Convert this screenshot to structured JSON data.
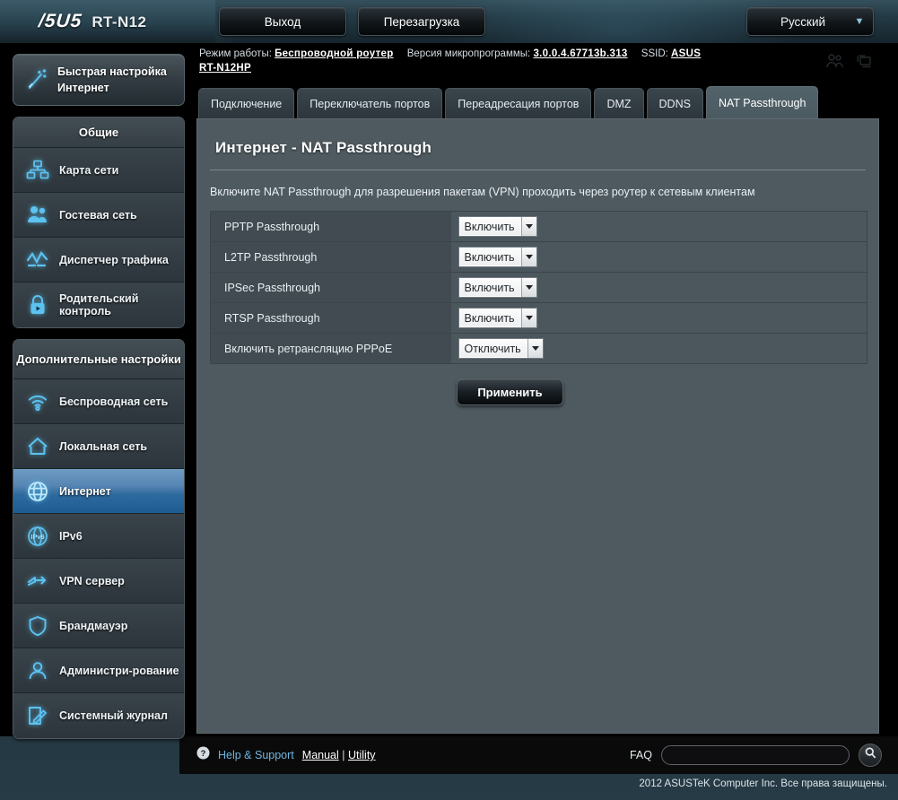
{
  "header": {
    "brand": "/5U5",
    "model": "RT-N12",
    "logout_label": "Выход",
    "reboot_label": "Перезагрузка",
    "language": "Русский",
    "language_caret": "chevron-down-icon"
  },
  "infobar": {
    "mode_label": "Режим работы:",
    "mode_value": "Беспроводной  роутер",
    "firmware_label": "Версия микропрограммы:",
    "firmware_value": "3.0.0.4.67713b.313",
    "ssid_label": "SSID:",
    "ssid_value": "ASUS",
    "ssid_value2": "RT-N12HP",
    "icons": [
      "clients-icon",
      "devices-icon"
    ]
  },
  "tabs": [
    {
      "label": "Подключение",
      "active": false
    },
    {
      "label": "Переключатель портов",
      "active": false
    },
    {
      "label": "Переадресация портов",
      "active": false
    },
    {
      "label": "DMZ",
      "active": false
    },
    {
      "label": "DDNS",
      "active": false
    },
    {
      "label": "NAT Passthrough",
      "active": true
    }
  ],
  "sidebar": {
    "quick_setup": {
      "line1": "Быстрая настройка",
      "line2": "Интернет",
      "icon": "wand-icon"
    },
    "groups": [
      {
        "title": "Общие",
        "items": [
          {
            "label": "Карта сети",
            "icon": "network-map-icon",
            "active": false
          },
          {
            "label": "Гостевая сеть",
            "icon": "guest-network-icon",
            "active": false
          },
          {
            "label": "Диспетчер трафика",
            "icon": "traffic-manager-icon",
            "active": false
          },
          {
            "label": "Родительский контроль",
            "icon": "parental-control-icon",
            "active": false
          }
        ]
      },
      {
        "title": "Дополнительные настройки",
        "items": [
          {
            "label": "Беспроводная сеть",
            "icon": "wifi-icon",
            "active": false
          },
          {
            "label": "Локальная сеть",
            "icon": "home-icon",
            "active": false
          },
          {
            "label": "Интернет",
            "icon": "globe-icon",
            "active": true
          },
          {
            "label": "IPv6",
            "icon": "ipv6-icon",
            "active": false
          },
          {
            "label": "VPN сервер",
            "icon": "vpn-icon",
            "active": false
          },
          {
            "label": "Брандмауэр",
            "icon": "shield-icon",
            "active": false
          },
          {
            "label": "Администри-рование",
            "icon": "admin-user-icon",
            "active": false
          },
          {
            "label": "Системный журнал",
            "icon": "syslog-icon",
            "active": false
          }
        ]
      }
    ]
  },
  "main": {
    "title": "Интернет - NAT Passthrough",
    "description": "Включите NAT Passthrough для разрешения пакетам (VPN) проходить через роутер к сетевым клиентам",
    "rows": [
      {
        "label": "PPTP Passthrough",
        "value": "Включить"
      },
      {
        "label": "L2TP Passthrough",
        "value": "Включить"
      },
      {
        "label": "IPSec Passthrough",
        "value": "Включить"
      },
      {
        "label": "RTSP Passthrough",
        "value": "Включить"
      },
      {
        "label": "Включить ретрансляцию PPPoE",
        "value": "Отключить"
      }
    ],
    "select_options": [
      "Включить",
      "Отключить"
    ],
    "apply_label": "Применить"
  },
  "footer": {
    "help_icon": "question-mark-icon",
    "help_label": "Help & Support",
    "manual_label": "Manual",
    "separator": "|",
    "utility_label": "Utility",
    "faq_label": "FAQ",
    "faq_value": "",
    "faq_placeholder": "",
    "search_icon": "search-icon",
    "copyright": "2012 ASUSTeK Computer Inc. Все права защищены."
  },
  "colors": {
    "accent_blue": "#2e6a9e",
    "panel_bg": "#4e5a60",
    "row_label_bg": "#414b51",
    "icon_glow": "#5abeeb"
  }
}
